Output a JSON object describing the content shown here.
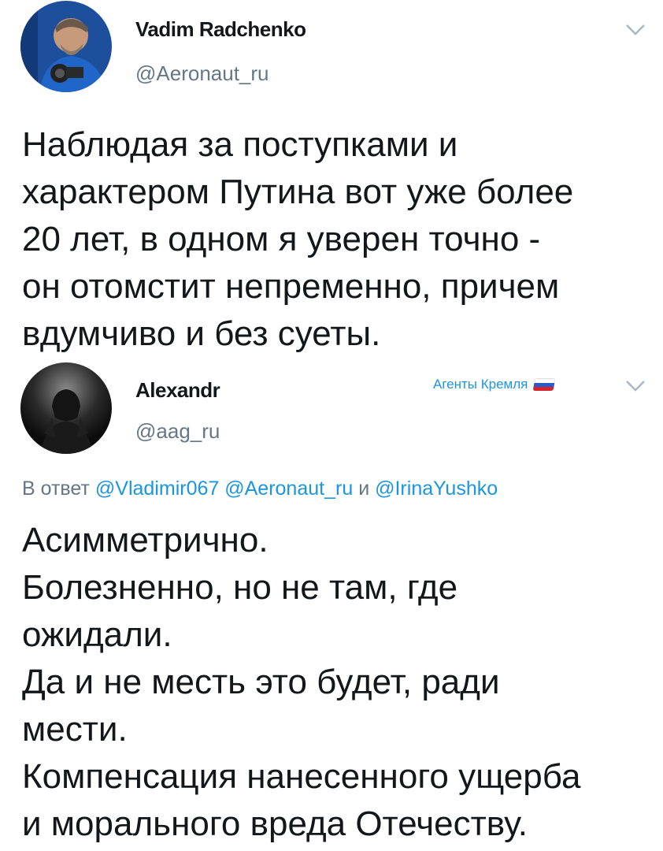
{
  "tweet1": {
    "author_name": "Vadim Radchenko",
    "author_handle": "@Aeronaut_ru",
    "text_lines": [
      "Наблюдая за поступками и",
      "характером Путина вот уже более",
      "20 лет, в одном я уверен точно -",
      "он отомстит непременно, причем",
      "вдумчиво и без суеты."
    ]
  },
  "tweet2": {
    "author_name": "Alexandr",
    "author_handle": "@aag_ru",
    "badge_label": "Агенты Кремля",
    "reply_prefix": "В ответ",
    "reply_mentions": [
      "@Vladimir067",
      "@Aeronaut_ru"
    ],
    "reply_and": "и",
    "reply_last_mention": "@IrinaYushko",
    "text_lines": [
      "Асимметрично.",
      "Болезненно, но не там, где",
      "ожидали.",
      "Да и не месть это будет, ради",
      "мести.",
      "Компенсация нанесенного ущерба",
      "и морального вреда Отечеству."
    ]
  },
  "icons": {
    "tweet_menu": "chevron-down-icon",
    "badge_flag": "russian-flag-icon"
  },
  "colors": {
    "text": "#14171a",
    "secondary": "#657786",
    "link": "#1b95e0",
    "chevron": "#aab8c2",
    "flag_white": "#ffffff",
    "flag_blue": "#2b5bc7",
    "flag_red": "#d8232a"
  }
}
